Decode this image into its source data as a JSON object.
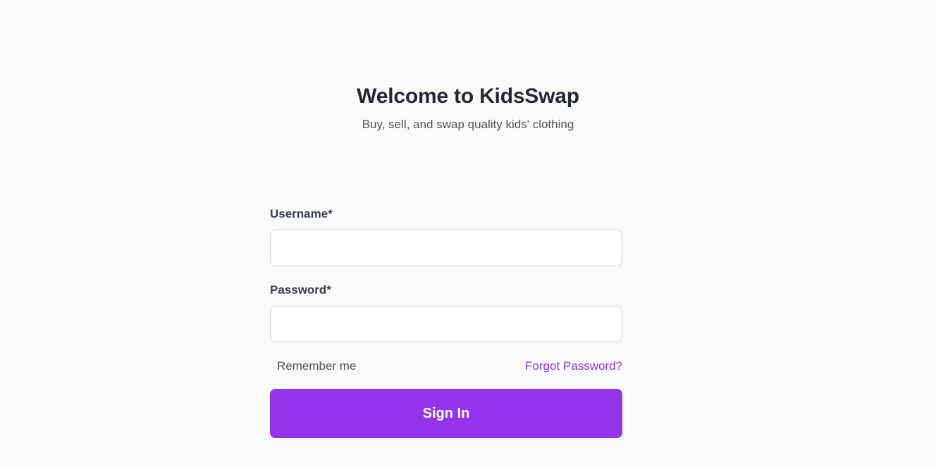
{
  "header": {
    "title": "Welcome to KidsSwap",
    "subtitle": "Buy, sell, and swap quality kids' clothing"
  },
  "form": {
    "username": {
      "label": "Username*",
      "value": "",
      "placeholder": ""
    },
    "password": {
      "label": "Password*",
      "value": "",
      "placeholder": ""
    },
    "remember_label": "Remember me",
    "forgot_label": "Forgot Password?",
    "submit_label": "Sign In"
  },
  "colors": {
    "background": "#f9fafb",
    "accent": "#9333ea",
    "text_primary": "#1f2937",
    "text_secondary": "#4b5563",
    "input_border": "#d1d5db"
  }
}
